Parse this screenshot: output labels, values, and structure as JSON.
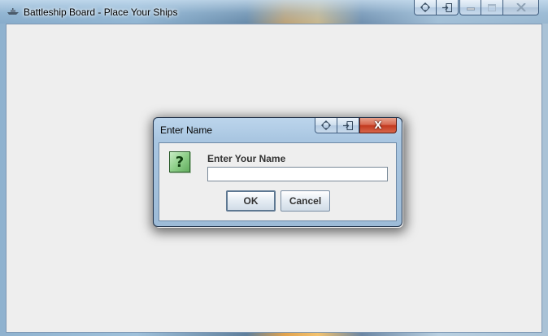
{
  "window": {
    "title": "Battleship Board - Place Your Ships",
    "icon": "ship-icon",
    "controls": [
      "move-icon",
      "snap-icon",
      "minimize-icon",
      "maximize-icon",
      "close-icon"
    ]
  },
  "dialog": {
    "title": "Enter Name",
    "icon": "question-icon",
    "icon_glyph": "?",
    "close_glyph": "X",
    "prompt_label": "Enter Your Name",
    "name_value": "",
    "name_placeholder": "",
    "ok_label": "OK",
    "cancel_label": "Cancel"
  },
  "colors": {
    "client_bg": "#eeeeee",
    "close_red": "#c2391e",
    "question_green": "#8fcf8a"
  }
}
